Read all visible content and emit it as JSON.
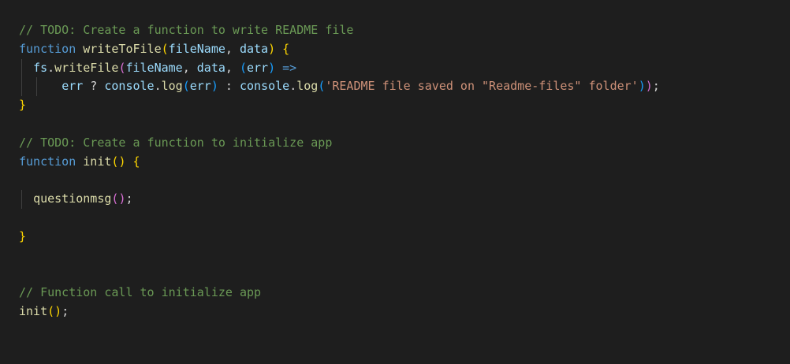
{
  "editor": {
    "theme_colors": {
      "background": "#1e1e1e",
      "comment": "#6a9955",
      "keyword": "#569cd6",
      "function": "#dcdcaa",
      "variable": "#9cdcfe",
      "string": "#ce9178",
      "bracket_level_1": "#ffd700",
      "bracket_level_2": "#da70d6",
      "bracket_level_3": "#179fff"
    },
    "lines": [
      {
        "guides": 0,
        "tokens": [
          {
            "t": "// TODO: Create a function to write README file",
            "c": "comment"
          }
        ]
      },
      {
        "guides": 0,
        "tokens": [
          {
            "t": "function",
            "c": "keyword"
          },
          {
            "t": " ",
            "c": "plain"
          },
          {
            "t": "writeToFile",
            "c": "func"
          },
          {
            "t": "(",
            "c": "b1"
          },
          {
            "t": "fileName",
            "c": "param"
          },
          {
            "t": ", ",
            "c": "plain"
          },
          {
            "t": "data",
            "c": "param"
          },
          {
            "t": ")",
            "c": "b1"
          },
          {
            "t": " ",
            "c": "plain"
          },
          {
            "t": "{",
            "c": "b1"
          }
        ]
      },
      {
        "guides": 1,
        "tokens": [
          {
            "t": "  ",
            "c": "plain"
          },
          {
            "t": "fs",
            "c": "param"
          },
          {
            "t": ".",
            "c": "plain"
          },
          {
            "t": "writeFile",
            "c": "func"
          },
          {
            "t": "(",
            "c": "b2"
          },
          {
            "t": "fileName",
            "c": "param"
          },
          {
            "t": ", ",
            "c": "plain"
          },
          {
            "t": "data",
            "c": "param"
          },
          {
            "t": ", ",
            "c": "plain"
          },
          {
            "t": "(",
            "c": "b3"
          },
          {
            "t": "err",
            "c": "param"
          },
          {
            "t": ")",
            "c": "b3"
          },
          {
            "t": " ",
            "c": "plain"
          },
          {
            "t": "=>",
            "c": "keyword"
          }
        ]
      },
      {
        "guides": 2,
        "tokens": [
          {
            "t": "      ",
            "c": "plain"
          },
          {
            "t": "err",
            "c": "param"
          },
          {
            "t": " ? ",
            "c": "plain"
          },
          {
            "t": "console",
            "c": "param"
          },
          {
            "t": ".",
            "c": "plain"
          },
          {
            "t": "log",
            "c": "func"
          },
          {
            "t": "(",
            "c": "b3"
          },
          {
            "t": "err",
            "c": "param"
          },
          {
            "t": ")",
            "c": "b3"
          },
          {
            "t": " : ",
            "c": "plain"
          },
          {
            "t": "console",
            "c": "param"
          },
          {
            "t": ".",
            "c": "plain"
          },
          {
            "t": "log",
            "c": "func"
          },
          {
            "t": "(",
            "c": "b3"
          },
          {
            "t": "'README file saved on \"Readme-files\" folder'",
            "c": "string"
          },
          {
            "t": ")",
            "c": "b3"
          },
          {
            "t": ")",
            "c": "b2"
          },
          {
            "t": ";",
            "c": "plain"
          }
        ]
      },
      {
        "guides": 0,
        "tokens": [
          {
            "t": "}",
            "c": "b1"
          }
        ]
      },
      {
        "guides": 0,
        "tokens": []
      },
      {
        "guides": 0,
        "tokens": [
          {
            "t": "// TODO: Create a function to initialize app",
            "c": "comment"
          }
        ]
      },
      {
        "guides": 0,
        "tokens": [
          {
            "t": "function",
            "c": "keyword"
          },
          {
            "t": " ",
            "c": "plain"
          },
          {
            "t": "init",
            "c": "func"
          },
          {
            "t": "(",
            "c": "b1"
          },
          {
            "t": ")",
            "c": "b1"
          },
          {
            "t": " ",
            "c": "plain"
          },
          {
            "t": "{",
            "c": "b1"
          }
        ]
      },
      {
        "guides": 1,
        "tokens": []
      },
      {
        "guides": 1,
        "tokens": [
          {
            "t": "  ",
            "c": "plain"
          },
          {
            "t": "questionmsg",
            "c": "func"
          },
          {
            "t": "(",
            "c": "b2"
          },
          {
            "t": ")",
            "c": "b2"
          },
          {
            "t": ";",
            "c": "plain"
          }
        ]
      },
      {
        "guides": 1,
        "tokens": []
      },
      {
        "guides": 0,
        "tokens": [
          {
            "t": "}",
            "c": "b1"
          }
        ]
      },
      {
        "guides": 0,
        "tokens": []
      },
      {
        "guides": 0,
        "tokens": []
      },
      {
        "guides": 0,
        "tokens": [
          {
            "t": "// Function call to initialize app",
            "c": "comment"
          }
        ]
      },
      {
        "guides": 0,
        "tokens": [
          {
            "t": "init",
            "c": "func"
          },
          {
            "t": "(",
            "c": "b1"
          },
          {
            "t": ")",
            "c": "b1"
          },
          {
            "t": ";",
            "c": "plain"
          }
        ]
      }
    ]
  }
}
